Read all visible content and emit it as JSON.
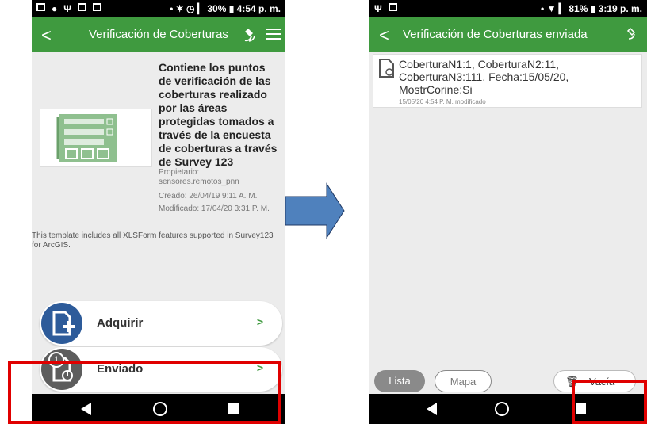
{
  "left_phone": {
    "status": {
      "right": "• ✶ ◷ ▎ 30% ▮ 4:54 p. m."
    },
    "appbar": {
      "back": "<",
      "title": "Verificación de Coberturas"
    },
    "description": "Contiene los puntos de verificación de las coberturas realizado por las áreas protegidas tomados a través de la encuesta de coberturas a través de Survey 123",
    "owner_label": "Propietario:",
    "owner_value": "sensores.remotos_pnn",
    "created": "Creado: 26/04/19 9:11 A. M.",
    "modified": "Modificado: 17/04/20 3:31 P. M.",
    "template_note": "This template includes all XLSForm features supported in Survey123 for ArcGIS.",
    "actions": [
      {
        "label": "Adquirir",
        "chevron": ">",
        "color": "#2d5b9a"
      },
      {
        "label": "Enviado",
        "chevron": ">",
        "color": "#5d5d5d",
        "badge": "1"
      }
    ]
  },
  "right_phone": {
    "status": {
      "right": "• ▼ ▎ 81% ▮ 3:19 p. m."
    },
    "appbar": {
      "back": "<",
      "title": "Verificación de Coberturas enviada"
    },
    "item": {
      "text": "CoberturaN1:1, CoberturaN2:11, CoberturaN3:111, Fecha:15/05/20, MostrCorine:Si",
      "sub": "15/05/20 4:54 P. M. modificado"
    },
    "bottom": {
      "lista": "Lista",
      "mapa": "Mapa",
      "vacia": "Vacía"
    }
  },
  "colors": {
    "appbar": "#3f9a3f",
    "arrow": "#4f81bd",
    "highlight": "#e00000"
  }
}
